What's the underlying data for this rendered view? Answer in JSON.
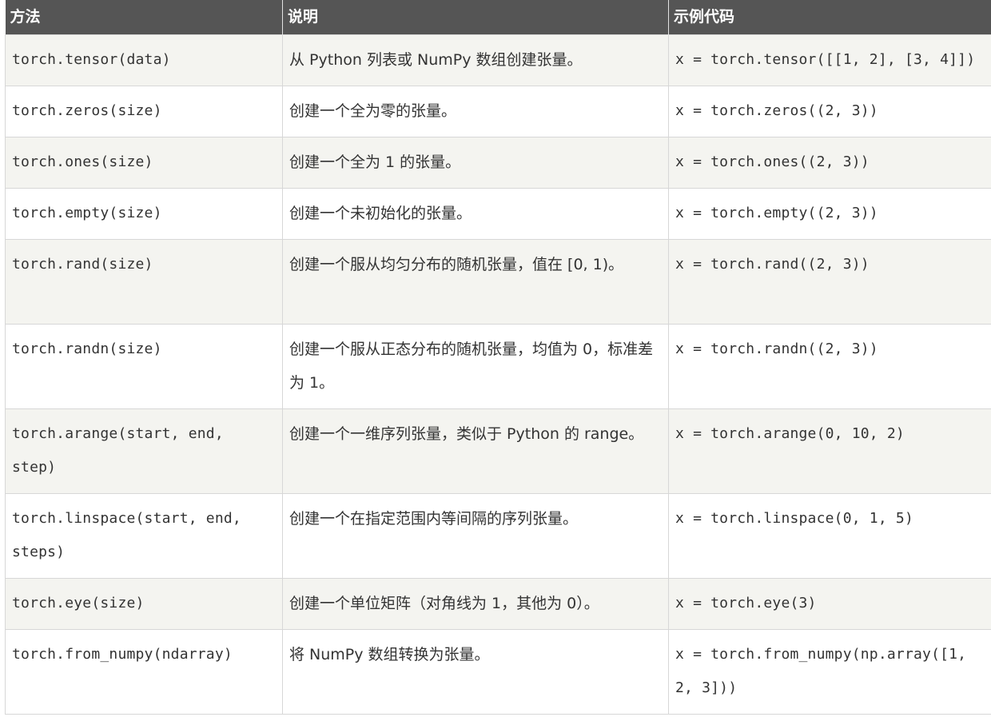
{
  "table": {
    "headers": [
      "方法",
      "说明",
      "示例代码"
    ],
    "rows": [
      {
        "method": "torch.tensor(data)",
        "desc": "从 Python 列表或 NumPy 数组创建张量。",
        "example": "x = torch.tensor([[1, 2], [3, 4]])"
      },
      {
        "method": "torch.zeros(size)",
        "desc": "创建一个全为零的张量。",
        "example": "x = torch.zeros((2, 3))"
      },
      {
        "method": "torch.ones(size)",
        "desc": "创建一个全为 1 的张量。",
        "example": "x = torch.ones((2, 3))"
      },
      {
        "method": "torch.empty(size)",
        "desc": "创建一个未初始化的张量。",
        "example": "x = torch.empty((2, 3))"
      },
      {
        "method": "torch.rand(size)",
        "desc": "创建一个服从均匀分布的随机张量，值在 [0, 1)。",
        "example": "x = torch.rand((2, 3))"
      },
      {
        "method": "torch.randn(size)",
        "desc": "创建一个服从正态分布的随机张量，均值为 0，标准差为 1。",
        "example": "x = torch.randn((2, 3))"
      },
      {
        "method": "torch.arange(start, end, step)",
        "desc": "创建一个一维序列张量，类似于 Python 的 range。",
        "example": "x = torch.arange(0, 10, 2)"
      },
      {
        "method": "torch.linspace(start, end, steps)",
        "desc": "创建一个在指定范围内等间隔的序列张量。",
        "example": "x = torch.linspace(0, 1, 5)"
      },
      {
        "method": "torch.eye(size)",
        "desc": "创建一个单位矩阵（对角线为 1，其他为 0）。",
        "example": "x = torch.eye(3)"
      },
      {
        "method": "torch.from_numpy(ndarray)",
        "desc": "将 NumPy 数组转换为张量。",
        "example": "x = torch.from_numpy(np.array([1, 2, 3]))"
      }
    ]
  }
}
